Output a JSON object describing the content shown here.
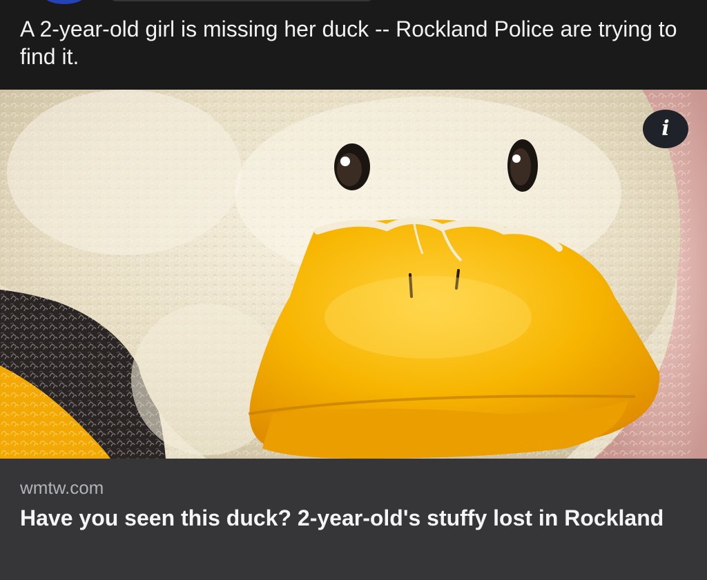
{
  "post": {
    "caption": "A 2-year-old girl is missing her duck -- Rockland Police are trying to find it."
  },
  "image": {
    "subject": "stuffed-duck-photo",
    "info_icon": "info-icon",
    "info_glyph": "i"
  },
  "link_preview": {
    "domain": "wmtw.com",
    "headline": "Have you seen this duck? 2-year-old's stuffy lost in Rockland"
  },
  "colors": {
    "background": "#1a1a1b",
    "card_background": "#363638",
    "beak": "#f5a800",
    "plush": "#ece4cf"
  }
}
